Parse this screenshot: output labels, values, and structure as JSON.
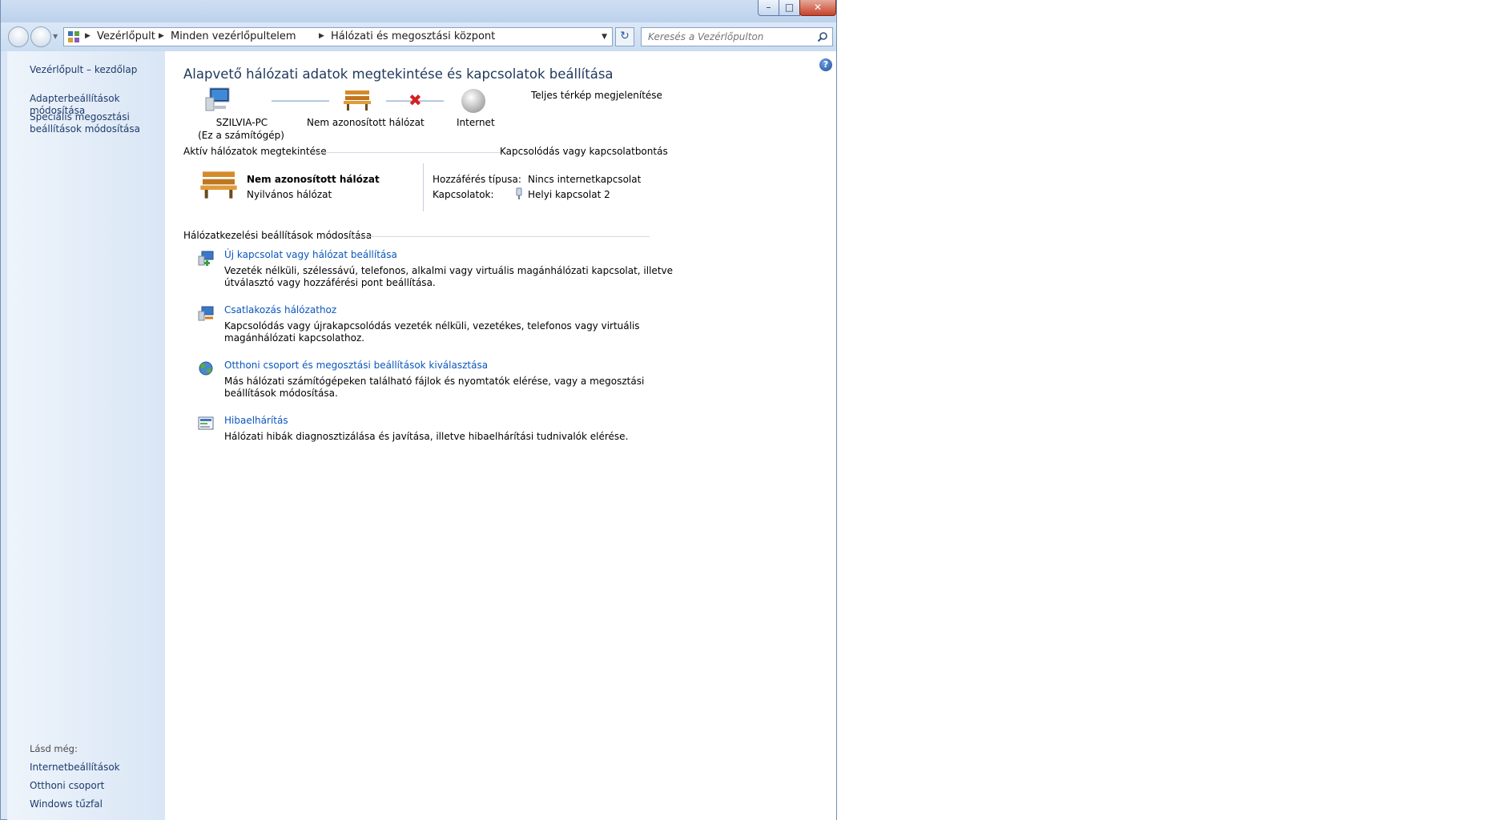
{
  "window": {
    "caption_buttons": {
      "minimize_icon": "minimize-icon",
      "maximize_icon": "maximize-icon",
      "close_icon": "close-icon"
    }
  },
  "navbar": {
    "breadcrumbs": [
      "Vezérlőpult",
      "Minden vezérlőpultelem",
      "Hálózati és megosztási központ"
    ],
    "search_placeholder": "Keresés a Vezérlőpulton"
  },
  "sidebar": {
    "home": "Vezérlőpult – kezdőlap",
    "links": [
      "Adapterbeállítások módosítása",
      "Speciális megosztási beállítások módosítása"
    ],
    "see_also_label": "Lásd még:",
    "see_also": [
      "Internetbeállítások",
      "Otthoni csoport",
      "Windows tűzfal"
    ]
  },
  "main": {
    "title": "Alapvető hálózati adatok megtekintése és kapcsolatok beállítása",
    "full_map_link": "Teljes térkép megjelenítése",
    "map": {
      "computer_name": "SZILVIA-PC",
      "computer_sub": "(Ez a számítógép)",
      "network_name": "Nem azonosított hálózat",
      "internet": "Internet"
    },
    "active_networks_header": "Aktív hálózatok megtekintése",
    "connect_disconnect_link": "Kapcsolódás vagy kapcsolatbontás",
    "network": {
      "name": "Nem azonosított hálózat",
      "type": "Nyilvános hálózat",
      "access_label": "Hozzáférés típusa:",
      "access_value": "Nincs internetkapcsolat",
      "connections_label": "Kapcsolatok:",
      "connections_value": "Helyi kapcsolat 2"
    },
    "change_settings_header": "Hálózatkezelési beállítások módosítása",
    "tasks": [
      {
        "title": "Új kapcsolat vagy hálózat beállítása",
        "desc": "Vezeték nélküli, szélessávú, telefonos, alkalmi vagy virtuális magánhálózati kapcsolat, illetve útválasztó vagy hozzáférési pont beállítása."
      },
      {
        "title": "Csatlakozás hálózathoz",
        "desc": "Kapcsolódás vagy újrakapcsolódás vezeték nélküli, vezetékes, telefonos vagy virtuális magánhálózati kapcsolathoz."
      },
      {
        "title": "Otthoni csoport és megosztási beállítások kiválasztása",
        "desc": "Más hálózati számítógépeken található fájlok és nyomtatók elérése, vagy a megosztási beállítások módosítása."
      },
      {
        "title": "Hibaelhárítás",
        "desc": "Hálózati hibák diagnosztizálása és javítása, illetve hibaelhárítási tudnivalók elérése."
      }
    ]
  }
}
